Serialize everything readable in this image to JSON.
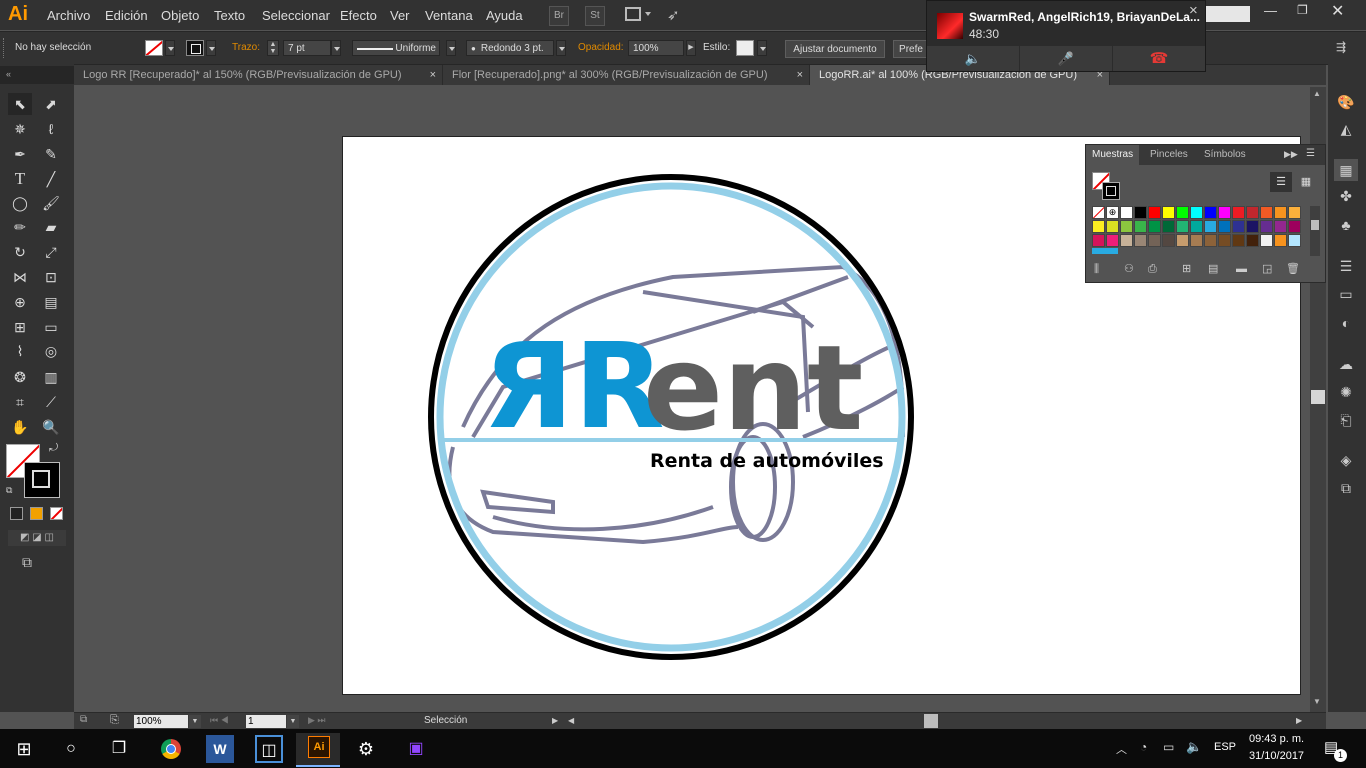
{
  "app": {
    "logo": "Ai",
    "menus": [
      "Archivo",
      "Edición",
      "Objeto",
      "Texto",
      "Seleccionar",
      "Efecto",
      "Ver",
      "Ventana",
      "Ayuda"
    ],
    "bridge_label": "Br",
    "stock_label": "St"
  },
  "control_bar": {
    "selection_status": "No hay selección",
    "stroke_label": "Trazo:",
    "stroke_weight": "7 pt",
    "stroke_profile": "Uniforme",
    "brush_label": "Redondo 3 pt.",
    "opacity_label": "Opacidad:",
    "opacity_value": "100%",
    "style_label": "Estilo:",
    "document_setup_button": "Ajustar documento",
    "preferences_button": "Prefe"
  },
  "tabs": [
    {
      "label": "Logo RR [Recuperado]* al 150% (RGB/Previsualización de GPU)",
      "close": "×"
    },
    {
      "label": "Flor [Recuperado].png* al 300% (RGB/Previsualización de GPU)",
      "close": "×"
    },
    {
      "label": "LogoRR.ai* al 100% (RGB/Previsualización de GPU)",
      "close": "×"
    }
  ],
  "artwork": {
    "logo_letters": "ЯR",
    "logo_word": "ent",
    "tagline": "Renta de automóviles",
    "colors": {
      "logo_blue": "#0e95d3",
      "logo_gray": "#5f5f5f",
      "ring_blue": "#93cfe8",
      "ring_black": "#000000",
      "car_outline": "#7a7a98"
    }
  },
  "swatches_panel": {
    "tabs": [
      "Muestras",
      "Pinceles",
      "Símbolos"
    ],
    "colors_row1": [
      "#ffffff",
      "#000000",
      "#ff0000",
      "#ffff00",
      "#00ff00",
      "#00ffff",
      "#0000ff",
      "#ff00ff",
      "#ed1c24",
      "#c1272d",
      "#f15a24",
      "#f7931e",
      "#fbb03b"
    ],
    "colors_row2": [
      "#fcee21",
      "#d9e021",
      "#8cc63f",
      "#39b54a",
      "#009245",
      "#006837",
      "#22b573",
      "#00a99d",
      "#29abe2",
      "#0071bc",
      "#2e3192",
      "#1b1464",
      "#662d91",
      "#93278f",
      "#9e005d"
    ],
    "colors_row3": [
      "#d4145a",
      "#ed1e79",
      "#c7b299",
      "#998675",
      "#736357",
      "#534741",
      "#c69c6d",
      "#a67c52",
      "#8c6239",
      "#754c24",
      "#603813",
      "#42210b",
      "#f2f2f2",
      "#f7931e",
      "#b3e6ff"
    ]
  },
  "call_popup": {
    "title": "SwarmRed, AngelRich19, BriayanDeLa...",
    "duration": "48:30",
    "close": "×"
  },
  "status_bar": {
    "zoom": "100%",
    "artboard_number": "1",
    "tool_name": "Selección"
  },
  "taskbar": {
    "language": "ESP",
    "time": "09:43 p. m.",
    "date": "31/10/2017",
    "notification_count": "1"
  }
}
